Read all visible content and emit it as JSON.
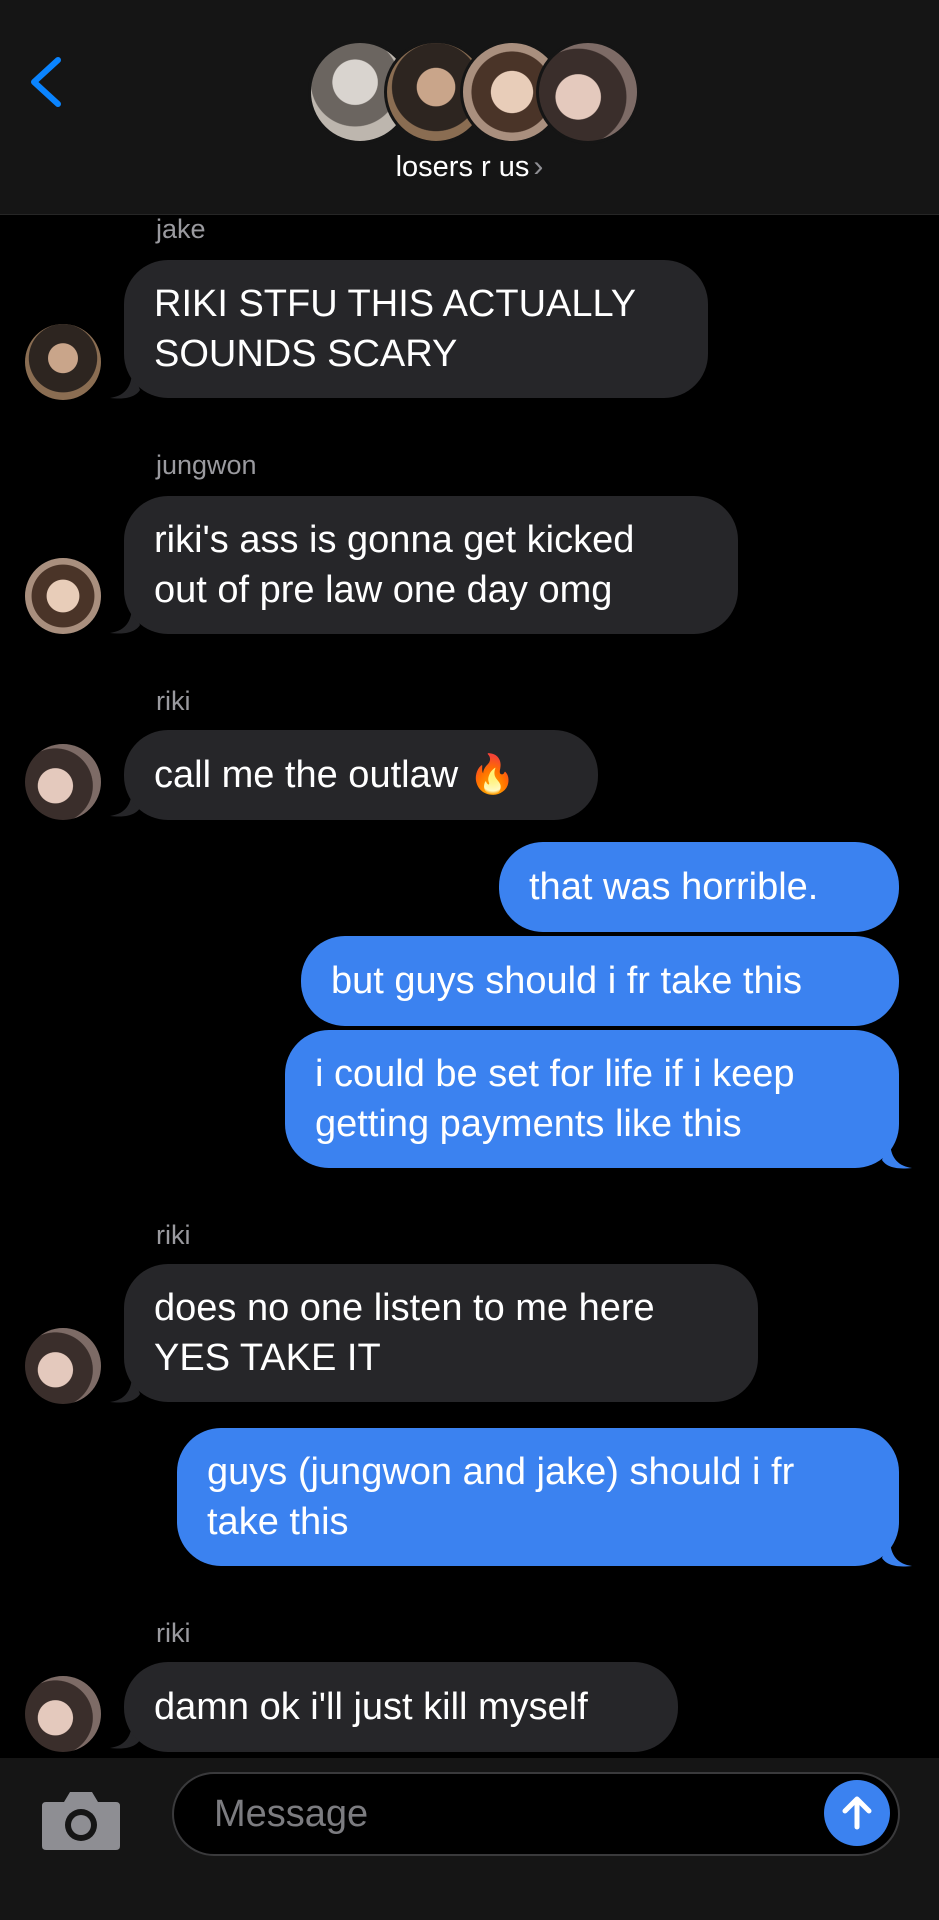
{
  "header": {
    "group_name": "losers r us",
    "chevron": "›",
    "back_icon": "chevron-left-icon"
  },
  "messages": [
    {
      "sender": "jake",
      "direction": "incoming",
      "lines": [
        "RIKI STFU THIS ACTUALLY",
        "SOUNDS SCARY"
      ]
    },
    {
      "sender": "jungwon",
      "direction": "incoming",
      "lines": [
        "riki's ass is gonna get kicked",
        "out of pre law one day omg"
      ]
    },
    {
      "sender": "riki",
      "direction": "incoming",
      "lines": [
        "call me the outlaw 🔥"
      ]
    },
    {
      "sender": "",
      "direction": "outgoing",
      "lines": [
        "that was horrible."
      ]
    },
    {
      "sender": "",
      "direction": "outgoing",
      "lines": [
        "but guys should i fr take this"
      ]
    },
    {
      "sender": "",
      "direction": "outgoing",
      "lines": [
        "i could be set for life if i keep",
        "getting payments like this"
      ]
    },
    {
      "sender": "riki",
      "direction": "incoming",
      "lines": [
        "does no one listen to me here",
        "YES TAKE IT"
      ]
    },
    {
      "sender": "",
      "direction": "outgoing",
      "lines": [
        "guys (jungwon and jake) should i fr",
        "take this"
      ]
    },
    {
      "sender": "riki",
      "direction": "incoming",
      "lines": [
        "damn ok i'll just kill myself"
      ]
    }
  ],
  "composer": {
    "placeholder": "Message",
    "camera_icon": "camera-icon",
    "send_icon": "arrow-up-icon"
  },
  "colors": {
    "accent": "#3b82f0",
    "incoming_bubble": "#262629",
    "background": "#000000",
    "bar": "#151515"
  }
}
